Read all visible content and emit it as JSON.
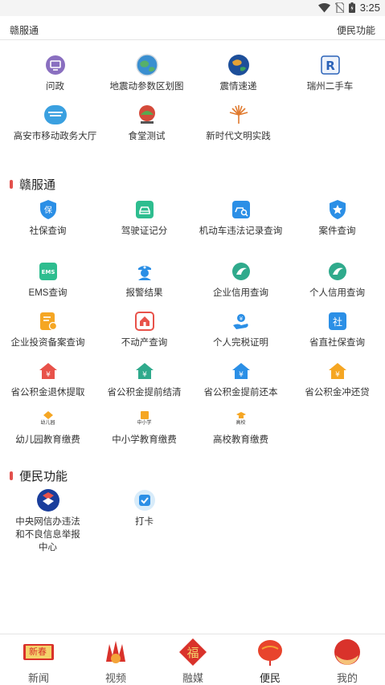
{
  "status": {
    "time": "3:25"
  },
  "top_tabs": {
    "left": "赣服通",
    "right": "便民功能"
  },
  "featured": [
    {
      "label": "问政",
      "icon": "monitor-icon"
    },
    {
      "label": "地震动参数区划图",
      "icon": "earth-globe-icon"
    },
    {
      "label": "震情速递",
      "icon": "earth-blue-icon"
    },
    {
      "label": "瑞州二手车",
      "icon": "car-logo-icon"
    },
    {
      "label": "高安市移动政务大厅",
      "icon": "gov-hall-icon"
    },
    {
      "label": "食堂测试",
      "icon": "canteen-icon"
    },
    {
      "label": "新时代文明实践",
      "icon": "civilization-icon"
    }
  ],
  "section_gft": {
    "title": "赣服通"
  },
  "gft_items": [
    {
      "label": "社保查询",
      "icon": "shield-icon"
    },
    {
      "label": "驾驶证记分",
      "icon": "car-icon"
    },
    {
      "label": "机动车违法记录查询",
      "icon": "car-search-icon"
    },
    {
      "label": "案件查询",
      "icon": "badge-star-icon"
    },
    {
      "label": "EMS查询",
      "icon": "ems-icon"
    },
    {
      "label": "报警结果",
      "icon": "police-icon"
    },
    {
      "label": "企业信用查询",
      "icon": "credit-icon"
    },
    {
      "label": "个人信用查询",
      "icon": "credit-icon"
    },
    {
      "label": "企业投资备案查询",
      "icon": "document-icon"
    },
    {
      "label": "不动产查询",
      "icon": "house-icon"
    },
    {
      "label": "个人完税证明",
      "icon": "tax-hand-icon"
    },
    {
      "label": "省直社保查询",
      "icon": "social-icon"
    },
    {
      "label": "省公积金退休提取",
      "icon": "fund-house-icon"
    },
    {
      "label": "省公积金提前结清",
      "icon": "fund-house-icon"
    },
    {
      "label": "省公积金提前还本",
      "icon": "fund-house-icon"
    },
    {
      "label": "省公积金冲还贷",
      "icon": "fund-house-icon"
    },
    {
      "label": "幼儿园教育缴费",
      "icon": "kindergarten-icon",
      "tag": "幼儿园"
    },
    {
      "label": "中小学教育缴费",
      "icon": "school-icon",
      "tag": "中小学"
    },
    {
      "label": "高校教育缴费",
      "icon": "college-icon",
      "tag": "高校"
    }
  ],
  "section_bm": {
    "title": "便民功能"
  },
  "bm_items": [
    {
      "label": "中央网信办违法和不良信息举报中心",
      "icon": "report-center-icon"
    },
    {
      "label": "打卡",
      "icon": "check-in-icon"
    }
  ],
  "colors": {
    "purple": "#8a6fc0",
    "teal": "#2ebd8f",
    "blue": "#2b8fe6",
    "red": "#e8524a",
    "orange": "#f5a623",
    "green": "#2faa8c",
    "accent": "#e2504c"
  },
  "nav": [
    {
      "label": "新闻",
      "icon": "news-icon",
      "badge": "新春"
    },
    {
      "label": "视频",
      "icon": "video-icon"
    },
    {
      "label": "融媒",
      "icon": "media-icon",
      "badge": "福"
    },
    {
      "label": "便民",
      "icon": "service-icon"
    },
    {
      "label": "我的",
      "icon": "profile-icon"
    }
  ]
}
